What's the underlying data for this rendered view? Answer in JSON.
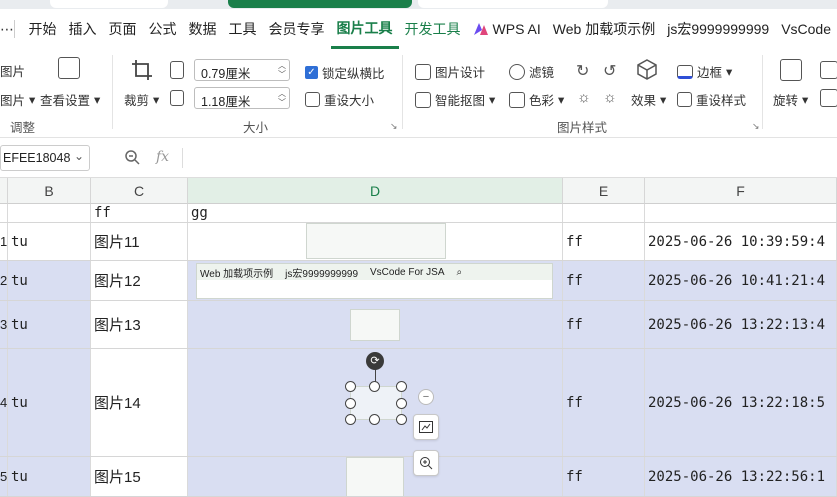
{
  "menu": {
    "items": [
      "开始",
      "插入",
      "页面",
      "公式",
      "数据",
      "工具",
      "会员专享"
    ],
    "active": "图片工具",
    "dev": "开发工具",
    "wps_ai": "WPS AI",
    "web_example": "Web 加载项示例",
    "js_macro": "js宏9999999999",
    "vscode": "VsCode"
  },
  "ribbon": {
    "picture_partial": "图片",
    "picture_partial2": "图片",
    "view_settings": "查看设置",
    "adjust_label": "调整",
    "crop": "裁剪",
    "width_value": "0.79厘米",
    "height_value": "1.18厘米",
    "lock_ratio": "锁定纵横比",
    "reset_size": "重设大小",
    "size_label": "大小",
    "picture_design": "图片设计",
    "filter": "滤镜",
    "smart_cutout": "智能抠图",
    "color": "色彩",
    "border": "边框",
    "effect": "效果",
    "reset_style": "重设样式",
    "style_label": "图片样式",
    "rotate": "旋转"
  },
  "formula": {
    "name_box": "EFEE18048",
    "fx": "fx"
  },
  "columns": [
    "B",
    "C",
    "D",
    "E",
    "F"
  ],
  "rows": [
    {
      "num": "",
      "b": "",
      "c": "ff",
      "d": "gg",
      "e": "",
      "f": "",
      "hl": false
    },
    {
      "num": "1",
      "b": "tu",
      "c": "图片11",
      "d": "",
      "e": "ff",
      "f": "2025-06-26 10:39:59:4",
      "hl": false
    },
    {
      "num": "2",
      "b": "tu",
      "c": "图片12",
      "d": "",
      "e": "ff",
      "f": "2025-06-26 10:41:21:4",
      "hl": true
    },
    {
      "num": "3",
      "b": "tu",
      "c": "图片13",
      "d": "",
      "e": "ff",
      "f": "2025-06-26 13:22:13:4",
      "hl": true
    },
    {
      "num": "4",
      "b": "tu",
      "c": "图片14",
      "d": "",
      "e": "ff",
      "f": "2025-06-26 13:22:18:5",
      "hl": true
    },
    {
      "num": "5",
      "b": "tu",
      "c": "图片15",
      "d": "",
      "e": "ff",
      "f": "2025-06-26 13:22:56:1",
      "hl": true
    }
  ],
  "img12": {
    "web": "Web 加载项示例",
    "js": "js宏9999999999",
    "vs": "VsCode For JSA"
  }
}
